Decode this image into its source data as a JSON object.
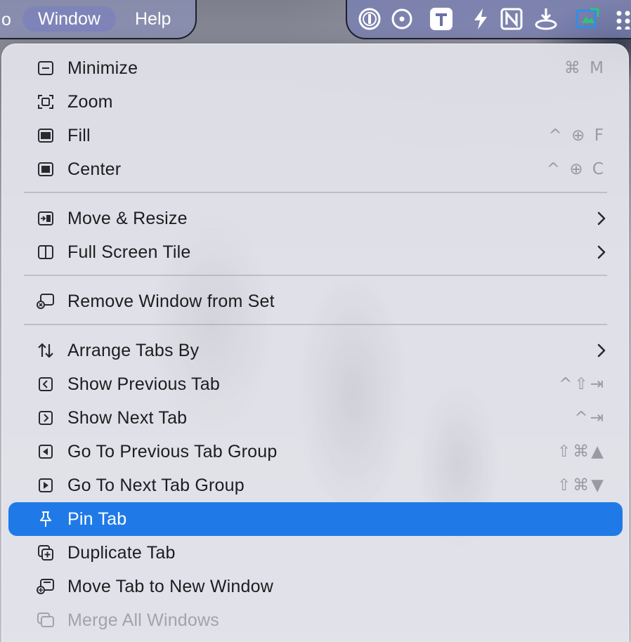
{
  "menubar": {
    "clipped_left": "o",
    "menus": [
      {
        "label": "Window"
      },
      {
        "label": "Help"
      }
    ],
    "status_icons": [
      "1password-icon",
      "circle-dot-icon",
      "typora-t-icon",
      "bolt-icon",
      "notion-n-icon",
      "download-tray-icon",
      "blue-app-icon",
      "dots-grid-icon"
    ]
  },
  "menu": {
    "items": [
      {
        "label": "Minimize",
        "shortcut": "⌘ M",
        "icon": "minimize-icon"
      },
      {
        "label": "Zoom",
        "shortcut": "",
        "icon": "zoom-icon"
      },
      {
        "label": "Fill",
        "shortcut": "^ ⊕ F",
        "icon": "fill-icon"
      },
      {
        "label": "Center",
        "shortcut": "^ ⊕ C",
        "icon": "center-icon"
      },
      {
        "label": "Move & Resize",
        "shortcut": "",
        "icon": "move-resize-icon",
        "submenu": true
      },
      {
        "label": "Full Screen Tile",
        "shortcut": "",
        "icon": "full-screen-tile-icon",
        "submenu": true
      },
      {
        "label": "Remove Window from Set",
        "shortcut": "",
        "icon": "remove-window-icon"
      },
      {
        "label": "Arrange Tabs By",
        "shortcut": "",
        "icon": "arrange-arrows-icon",
        "submenu": true
      },
      {
        "label": "Show Previous Tab",
        "shortcut": "^⇧⇥",
        "icon": "previous-tab-icon"
      },
      {
        "label": "Show Next Tab",
        "shortcut": "^⇥",
        "icon": "next-tab-icon"
      },
      {
        "label": "Go To Previous Tab Group",
        "shortcut": "⇧⌘▲",
        "icon": "previous-tab-group-icon"
      },
      {
        "label": "Go To Next Tab Group",
        "shortcut": "⇧⌘▼",
        "icon": "next-tab-group-icon"
      },
      {
        "label": "Pin Tab",
        "shortcut": "",
        "icon": "pin-icon",
        "highlighted": true
      },
      {
        "label": "Duplicate Tab",
        "shortcut": "",
        "icon": "duplicate-tab-icon"
      },
      {
        "label": "Move Tab to New Window",
        "shortcut": "",
        "icon": "move-tab-new-window-icon"
      },
      {
        "label": "Merge All Windows",
        "shortcut": "",
        "icon": "merge-windows-icon",
        "disabled": true
      }
    ]
  },
  "colors": {
    "highlight": "#1f7ae8",
    "text": "#1d1d1f",
    "shortcut": "#9a9aa2",
    "disabled": "#a3a3aa"
  }
}
